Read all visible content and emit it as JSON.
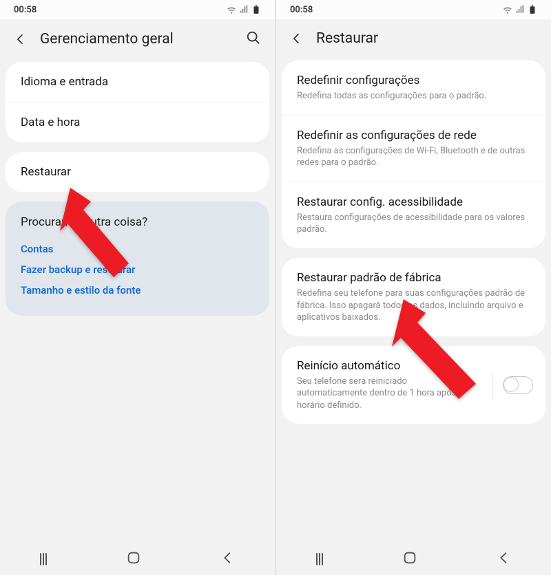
{
  "left": {
    "status": {
      "time": "00:58"
    },
    "header": {
      "title": "Gerenciamento geral"
    },
    "group1": [
      {
        "title": "Idioma e entrada"
      },
      {
        "title": "Data e hora"
      }
    ],
    "group2": [
      {
        "title": "Restaurar"
      }
    ],
    "info": {
      "question": "Procurando outra coisa?",
      "links": [
        "Contas",
        "Fazer backup e restaurar",
        "Tamanho e estilo da fonte"
      ]
    }
  },
  "right": {
    "status": {
      "time": "00:58"
    },
    "header": {
      "title": "Restaurar"
    },
    "group1": [
      {
        "title": "Redefinir configurações",
        "sub": "Redefina todas as configurações para o padrão."
      },
      {
        "title": "Redefinir as configurações de rede",
        "sub": "Redefina as configurações de Wi-Fi, Bluetooth e de outras redes para o padrão."
      },
      {
        "title": "Restaurar config. acessibilidade",
        "sub": "Restaura configurações de acessibilidade para os valores padrão."
      }
    ],
    "group2": [
      {
        "title": "Restaurar padrão de fábrica",
        "sub": "Redefina seu telefone para suas configurações padrão de fábrica. Isso apagará todos os dados, incluindo arquivo e aplicativos baixados."
      }
    ],
    "group3": {
      "title": "Reinício automático",
      "sub": "Seu telefone será reiniciado automaticamente dentro de 1 hora após o horário definido.",
      "enabled": false
    }
  },
  "colors": {
    "accent_red": "#ed1c24",
    "link_blue": "#1a6ed8"
  }
}
